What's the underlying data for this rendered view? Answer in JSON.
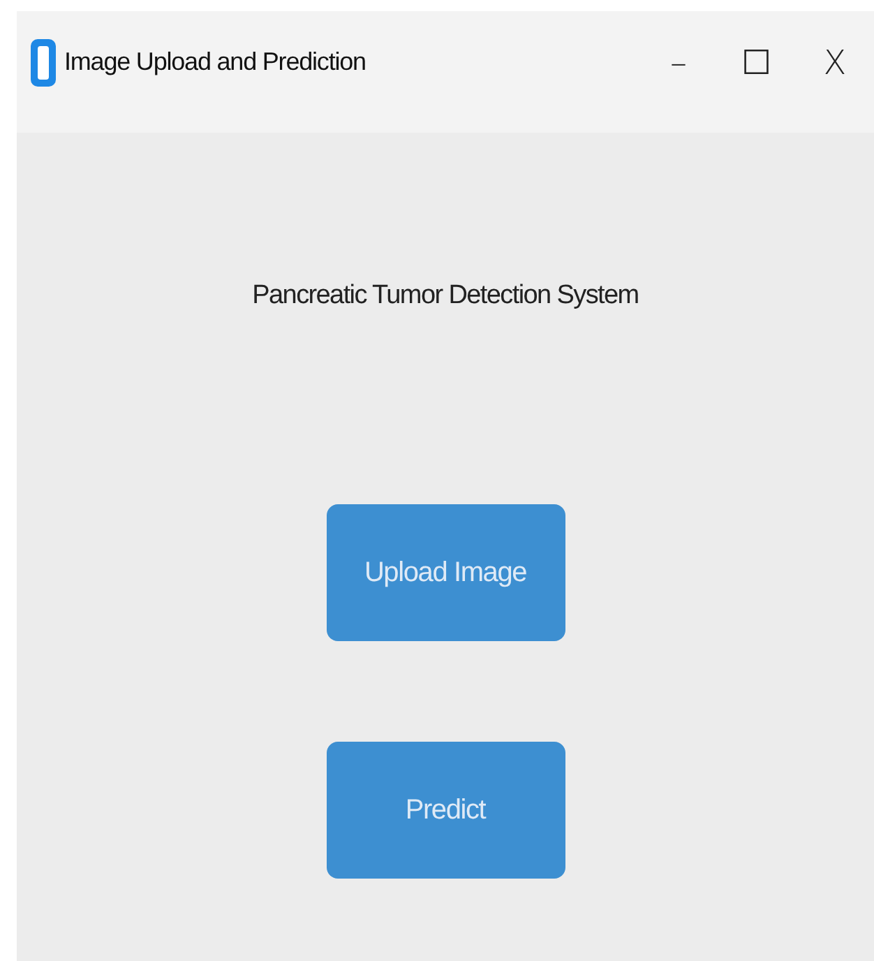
{
  "window": {
    "title": "Image Upload and Prediction",
    "controls": [
      "–",
      "☐",
      "X"
    ]
  },
  "heading": "Pancreatic Tumor Detection System",
  "buttons": [
    {
      "label": "Upload Image"
    },
    {
      "label": "Predict"
    }
  ]
}
